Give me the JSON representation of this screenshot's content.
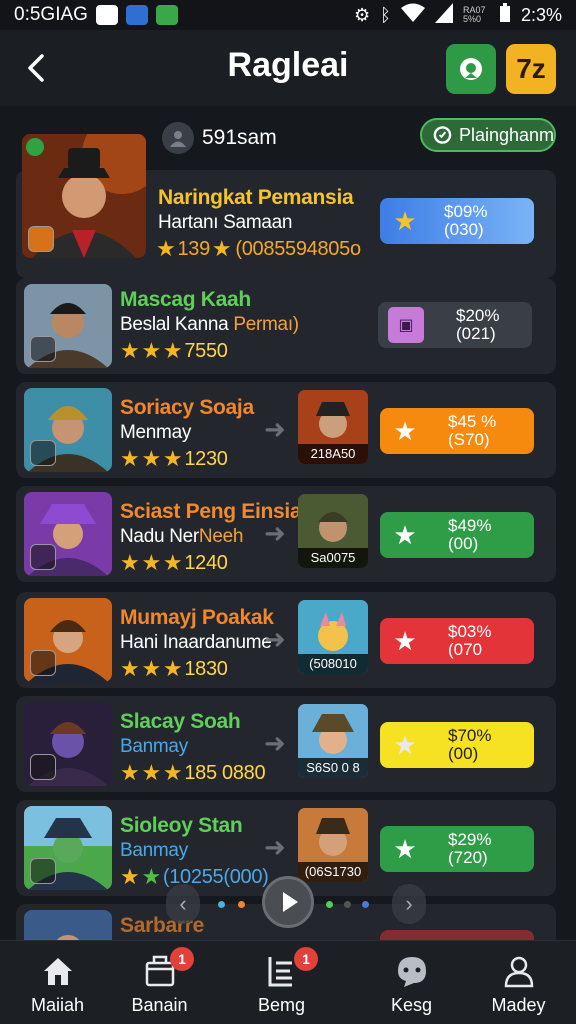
{
  "status_bar": {
    "carrier": "0:5GIAG",
    "battery": "2:3%",
    "small_label": "RA07 5%0"
  },
  "header": {
    "title": "Ragleai",
    "back_icon": "chevron-left-icon",
    "right_icons": [
      "camera-icon",
      "zz-icon"
    ],
    "colors": {
      "camera_button": "#2f9a45",
      "zz_button": "#f2b222"
    }
  },
  "featured": {
    "user_label": "591sam",
    "pill_label": "Plainghanm",
    "name": "Naringkat Pemansia",
    "subtitle": "Hartanı Samaan",
    "rating_text": "139",
    "rating_extra": "(0085594805o",
    "button_line1": "$09%",
    "button_line2": "(030)"
  },
  "items": [
    {
      "name": "Mascag Kaah",
      "subtitle": "Beslal Kanna",
      "subtitle_accent": "Permaı)",
      "rating_text": "7550",
      "button_line1": "$20%",
      "button_line2": "(021)",
      "name_color": "#5fcf5a",
      "button_style": "dark"
    },
    {
      "name": "Soriacy Soaja",
      "subtitle": "Menmay",
      "rating_text": "1230",
      "thumb_label": "218A50",
      "button_line1": "$45 %",
      "button_line2": "(S70)",
      "name_color": "#f2862a",
      "button_style": "orange"
    },
    {
      "name": "Sciast Peng Einsia",
      "subtitle": "Nadu Ner",
      "subtitle_accent": "Neeh",
      "rating_text": "1240",
      "thumb_label": "Sa0075",
      "button_line1": "$49%",
      "button_line2": "(00)",
      "name_color": "#f08a2c",
      "button_style": "green"
    },
    {
      "name": "Mumayj Poakak",
      "subtitle": "Hani Inaardanume",
      "rating_text": "1830",
      "thumb_label": "(508010",
      "button_line1": "$03%",
      "button_line2": "(070",
      "name_color": "#f2862a",
      "button_style": "red"
    },
    {
      "name": "Slacay Soah",
      "subtitle": "Banmay",
      "rating_text": "185 0880",
      "thumb_label": "S6S0 0 8",
      "button_line1": "$70%",
      "button_line2": "(00)",
      "name_color": "#5fcf5a",
      "button_style": "yellow"
    },
    {
      "name": "Sioleoy Stan",
      "subtitle": "Banmay",
      "rating_text": "(10255(000)",
      "thumb_label": "(06S1730",
      "button_line1": "$29%",
      "button_line2": "(720)",
      "name_color": "#5fcf5a",
      "button_style": "green"
    },
    {
      "name": "Sarbarre",
      "name_color": "#f2862a"
    }
  ],
  "bottom_nav": [
    {
      "label": "Maiiah",
      "icon": "home-icon",
      "badge": ""
    },
    {
      "label": "Banain",
      "icon": "store-icon",
      "badge": "1"
    },
    {
      "label": "Bemg",
      "icon": "list-icon",
      "badge": "1"
    },
    {
      "label": "Kesg",
      "icon": "chat-icon",
      "badge": ""
    },
    {
      "label": "Madey",
      "icon": "profile-icon",
      "badge": ""
    }
  ]
}
